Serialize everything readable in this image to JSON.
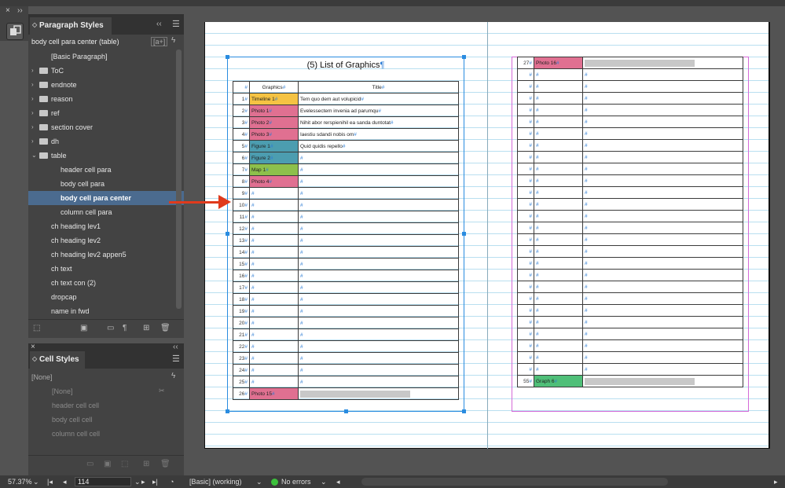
{
  "colors": {
    "timeline": "#f5c343",
    "photo": "#e07091",
    "figure": "#4c9db0",
    "map": "#8dc04b",
    "graph": "#4fbf78",
    "selected_row": "#4b6b8f",
    "arrow": "#e03a1c",
    "frame": "#2a8ce0"
  },
  "toolbar": {
    "close": "×",
    "expand": "››"
  },
  "paragraph_styles": {
    "tab_label": "Paragraph Styles",
    "current_style": "body cell para center (table)",
    "new_style_override": "[a+]",
    "lightning": "ϟ",
    "items": [
      {
        "label": "[Basic Paragraph]",
        "type": "style",
        "level": 1
      },
      {
        "label": "ToC",
        "type": "folder",
        "level": 0
      },
      {
        "label": "endnote",
        "type": "folder",
        "level": 0
      },
      {
        "label": "reason",
        "type": "folder",
        "level": 0
      },
      {
        "label": "ref",
        "type": "folder",
        "level": 0
      },
      {
        "label": "section cover",
        "type": "folder",
        "level": 0
      },
      {
        "label": "dh",
        "type": "folder",
        "level": 0
      },
      {
        "label": "table",
        "type": "folder-open",
        "level": 0
      },
      {
        "label": "header cell para",
        "type": "style",
        "level": 2
      },
      {
        "label": "body cell para",
        "type": "style",
        "level": 2
      },
      {
        "label": "body cell para center",
        "type": "style",
        "level": 2,
        "selected": true
      },
      {
        "label": "column cell para",
        "type": "style",
        "level": 2
      },
      {
        "label": "ch heading lev1",
        "type": "style",
        "level": 1
      },
      {
        "label": "ch heading lev2",
        "type": "style",
        "level": 1
      },
      {
        "label": "ch heading lev2 appen5",
        "type": "style",
        "level": 1
      },
      {
        "label": "ch text",
        "type": "style",
        "level": 1
      },
      {
        "label": "ch text con (2)",
        "type": "style",
        "level": 1
      },
      {
        "label": "dropcap",
        "type": "style",
        "level": 1
      },
      {
        "label": "name in fwd",
        "type": "style",
        "level": 1
      }
    ]
  },
  "cell_styles": {
    "tab_label": "Cell Styles",
    "current_style": "[None]",
    "items": [
      "[None]",
      "header cell cell",
      "body cell cell",
      "column cell cell"
    ]
  },
  "status": {
    "zoom": "57.37%",
    "page": "114",
    "style_set": "[Basic] (working)",
    "errors": "No errors"
  },
  "document": {
    "title": "(5) List of Graphics",
    "headers": [
      "",
      "Graphics",
      "Title"
    ],
    "left_rows": [
      {
        "n": "1",
        "g": "Timeline 1",
        "c": "timeline",
        "t": "Tem quo dem aut volupicid"
      },
      {
        "n": "2",
        "g": "Photo 1",
        "c": "photo",
        "t": "Evelessectem invenia ad parumqu"
      },
      {
        "n": "3",
        "g": "Photo 2",
        "c": "photo",
        "t": "Nihit abor rerspienihil ea sanda duntotat"
      },
      {
        "n": "4",
        "g": "Photo 3",
        "c": "photo",
        "t": "Iaestiu sdandi nobis om"
      },
      {
        "n": "5",
        "g": "Figure 1",
        "c": "figure",
        "t": "Quid quidis repello"
      },
      {
        "n": "6",
        "g": "Figure 2",
        "c": "figure",
        "t": ""
      },
      {
        "n": "7",
        "g": "Map 1",
        "c": "map",
        "t": ""
      },
      {
        "n": "8",
        "g": "Photo 4",
        "c": "photo",
        "t": ""
      },
      {
        "n": "9",
        "g": "",
        "c": "",
        "t": ""
      },
      {
        "n": "10",
        "g": "",
        "c": "",
        "t": ""
      },
      {
        "n": "11",
        "g": "",
        "c": "",
        "t": ""
      },
      {
        "n": "12",
        "g": "",
        "c": "",
        "t": ""
      },
      {
        "n": "13",
        "g": "",
        "c": "",
        "t": ""
      },
      {
        "n": "14",
        "g": "",
        "c": "",
        "t": ""
      },
      {
        "n": "15",
        "g": "",
        "c": "",
        "t": ""
      },
      {
        "n": "16",
        "g": "",
        "c": "",
        "t": ""
      },
      {
        "n": "17",
        "g": "",
        "c": "",
        "t": ""
      },
      {
        "n": "18",
        "g": "",
        "c": "",
        "t": ""
      },
      {
        "n": "19",
        "g": "",
        "c": "",
        "t": ""
      },
      {
        "n": "20",
        "g": "",
        "c": "",
        "t": ""
      },
      {
        "n": "21",
        "g": "",
        "c": "",
        "t": ""
      },
      {
        "n": "22",
        "g": "",
        "c": "",
        "t": ""
      },
      {
        "n": "23",
        "g": "",
        "c": "",
        "t": ""
      },
      {
        "n": "24",
        "g": "",
        "c": "",
        "t": ""
      },
      {
        "n": "25",
        "g": "",
        "c": "",
        "t": ""
      },
      {
        "n": "26",
        "g": "Photo 15",
        "c": "photo",
        "t": "",
        "bar": true
      }
    ],
    "right_rows": [
      {
        "n": "27",
        "g": "Photo 16",
        "c": "photo",
        "t": "",
        "bar": true
      },
      {
        "n": "",
        "g": "",
        "c": "",
        "t": ""
      },
      {
        "n": "",
        "g": "",
        "c": "",
        "t": ""
      },
      {
        "n": "",
        "g": "",
        "c": "",
        "t": ""
      },
      {
        "n": "",
        "g": "",
        "c": "",
        "t": ""
      },
      {
        "n": "",
        "g": "",
        "c": "",
        "t": ""
      },
      {
        "n": "",
        "g": "",
        "c": "",
        "t": ""
      },
      {
        "n": "",
        "g": "",
        "c": "",
        "t": ""
      },
      {
        "n": "",
        "g": "",
        "c": "",
        "t": ""
      },
      {
        "n": "",
        "g": "",
        "c": "",
        "t": ""
      },
      {
        "n": "",
        "g": "",
        "c": "",
        "t": ""
      },
      {
        "n": "",
        "g": "",
        "c": "",
        "t": ""
      },
      {
        "n": "",
        "g": "",
        "c": "",
        "t": ""
      },
      {
        "n": "",
        "g": "",
        "c": "",
        "t": ""
      },
      {
        "n": "",
        "g": "",
        "c": "",
        "t": ""
      },
      {
        "n": "",
        "g": "",
        "c": "",
        "t": ""
      },
      {
        "n": "",
        "g": "",
        "c": "",
        "t": ""
      },
      {
        "n": "",
        "g": "",
        "c": "",
        "t": ""
      },
      {
        "n": "",
        "g": "",
        "c": "",
        "t": ""
      },
      {
        "n": "",
        "g": "",
        "c": "",
        "t": ""
      },
      {
        "n": "",
        "g": "",
        "c": "",
        "t": ""
      },
      {
        "n": "",
        "g": "",
        "c": "",
        "t": ""
      },
      {
        "n": "",
        "g": "",
        "c": "",
        "t": ""
      },
      {
        "n": "",
        "g": "",
        "c": "",
        "t": ""
      },
      {
        "n": "",
        "g": "",
        "c": "",
        "t": ""
      },
      {
        "n": "",
        "g": "",
        "c": "",
        "t": ""
      },
      {
        "n": "",
        "g": "",
        "c": "",
        "t": ""
      },
      {
        "n": "55",
        "g": "Graph 6",
        "c": "graph",
        "t": "",
        "bar": true
      }
    ]
  }
}
